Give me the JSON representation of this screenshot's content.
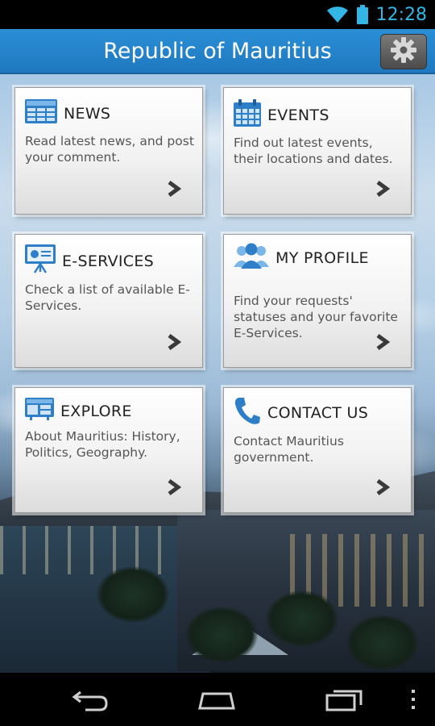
{
  "status_bar": {
    "time": "12:28",
    "icons": [
      "wifi-icon",
      "battery-icon"
    ],
    "accent_color": "#33b5e5"
  },
  "action_bar": {
    "title": "Republic of Mauritius",
    "settings_icon": "gear-icon",
    "background_color": "#2a8fd6"
  },
  "tiles": [
    {
      "title": "NEWS",
      "description": "Read latest news, and post your comment.",
      "icon": "newspaper-icon"
    },
    {
      "title": "EVENTS",
      "description": "Find out latest events, their locations and dates.",
      "icon": "calendar-icon"
    },
    {
      "title": "E-SERVICES",
      "description": "Check a list of available E-Services.",
      "icon": "presentation-icon"
    },
    {
      "title": "MY PROFILE",
      "description": "Find your requests' statuses and your favorite E-Services.",
      "icon": "users-icon"
    },
    {
      "title": "EXPLORE",
      "description": "About Mauritius: History, Politics, Geography.",
      "icon": "map-icon"
    },
    {
      "title": "CONTACT US",
      "description": "Contact Mauritius government.",
      "icon": "phone-icon"
    }
  ],
  "nav_bar": {
    "buttons": [
      "back-icon",
      "home-icon",
      "recent-apps-icon",
      "overflow-menu-icon"
    ]
  }
}
